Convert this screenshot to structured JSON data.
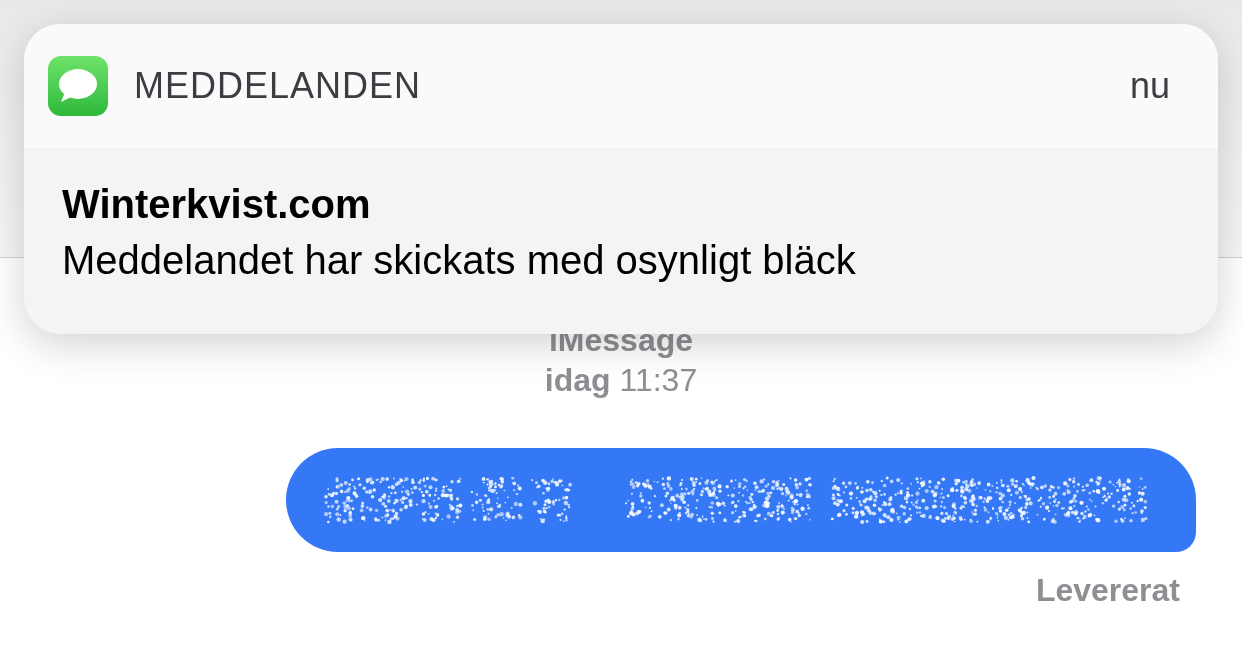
{
  "notification": {
    "app_name": "MEDDELANDEN",
    "time": "nu",
    "title": "Winterkvist.com",
    "body": "Meddelandet har skickats med osynligt bläck"
  },
  "conversation": {
    "service": "iMessage",
    "timestamp": "**idag** 11:37",
    "messages": [
      {
        "kind": "invisible_ink",
        "outgoing": true
      }
    ],
    "status": "Levererat"
  }
}
